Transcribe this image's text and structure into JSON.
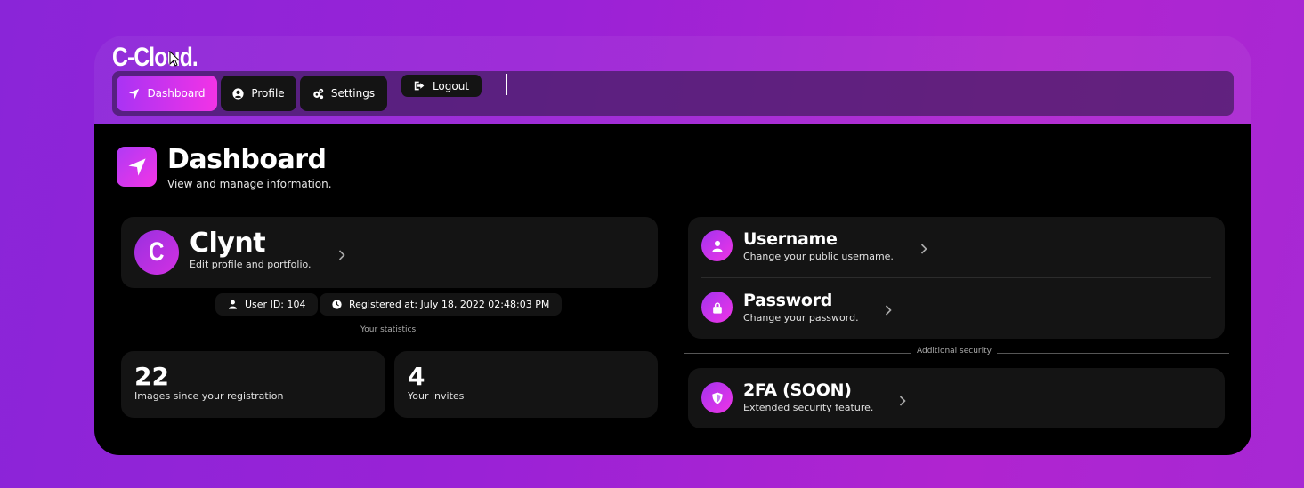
{
  "app": {
    "logo": "C-Cloud."
  },
  "nav": {
    "items": [
      {
        "label": "Dashboard",
        "icon": "location-arrow-icon",
        "active": true
      },
      {
        "label": "Profile",
        "icon": "user-circle-icon",
        "active": false
      },
      {
        "label": "Settings",
        "icon": "gears-icon",
        "active": false
      }
    ],
    "logout_label": "Logout"
  },
  "page": {
    "title": "Dashboard",
    "subtitle": "View and manage information."
  },
  "profile": {
    "avatar_letter": "C",
    "name": "Clynt",
    "subtitle": "Edit profile and portfolio.",
    "user_id": "User ID: 104",
    "registered": "Registered at: July 18, 2022 02:48:03 PM"
  },
  "statistics": {
    "heading": "Your statistics",
    "items": [
      {
        "value": "22",
        "label": "Images since your registration"
      },
      {
        "value": "4",
        "label": "Your invites"
      }
    ]
  },
  "account": {
    "username": {
      "title": "Username",
      "subtitle": "Change your public username."
    },
    "password": {
      "title": "Password",
      "subtitle": "Change your password."
    }
  },
  "security": {
    "heading": "Additional security",
    "tfa": {
      "title": "2FA (SOON)",
      "subtitle": "Extended security feature."
    }
  },
  "colors": {
    "accent_start": "#a933f4",
    "accent_end": "#f233e6",
    "panel": "#000000",
    "card": "#141414"
  }
}
